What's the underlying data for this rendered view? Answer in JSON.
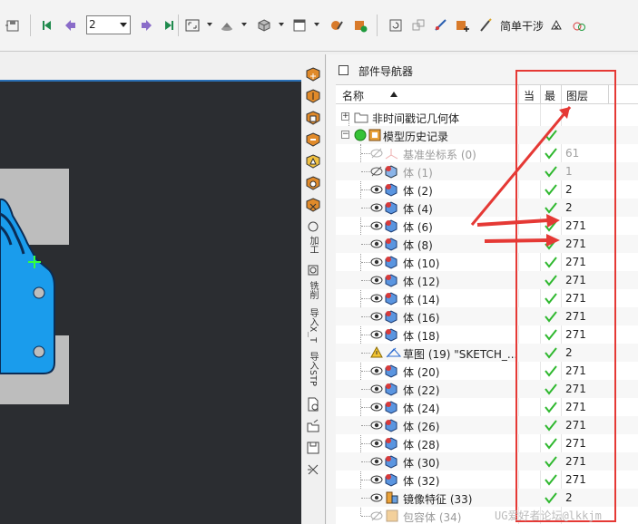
{
  "toolbar": {
    "page_value": "2",
    "simple_interference_label": "简单干涉"
  },
  "navigator": {
    "title": "部件导航器",
    "columns": {
      "name": "名称",
      "current": "当",
      "latest": "最",
      "layer": "图层"
    },
    "items": [
      {
        "label": "非时间戳记几何体",
        "layer": "",
        "checked": false,
        "dim": false,
        "kind": "folder"
      },
      {
        "label": "模型历史记录",
        "layer": "",
        "checked": true,
        "dim": false,
        "kind": "history"
      },
      {
        "label": "基准坐标系 (0)",
        "layer": "61",
        "checked": true,
        "dim": true,
        "kind": "csys"
      },
      {
        "label": "体 (1)",
        "layer": "1",
        "checked": true,
        "dim": true,
        "kind": "body"
      },
      {
        "label": "体 (2)",
        "layer": "2",
        "checked": true,
        "dim": false,
        "kind": "body"
      },
      {
        "label": "体 (4)",
        "layer": "2",
        "checked": true,
        "dim": false,
        "kind": "body"
      },
      {
        "label": "体 (6)",
        "layer": "271",
        "checked": true,
        "dim": false,
        "kind": "body"
      },
      {
        "label": "体 (8)",
        "layer": "271",
        "checked": true,
        "dim": false,
        "kind": "body"
      },
      {
        "label": "体 (10)",
        "layer": "271",
        "checked": true,
        "dim": false,
        "kind": "body"
      },
      {
        "label": "体 (12)",
        "layer": "271",
        "checked": true,
        "dim": false,
        "kind": "body"
      },
      {
        "label": "体 (14)",
        "layer": "271",
        "checked": true,
        "dim": false,
        "kind": "body"
      },
      {
        "label": "体 (16)",
        "layer": "271",
        "checked": true,
        "dim": false,
        "kind": "body"
      },
      {
        "label": "体 (18)",
        "layer": "271",
        "checked": true,
        "dim": false,
        "kind": "body"
      },
      {
        "label": "草图 (19) \"SKETCH_...",
        "layer": "2",
        "checked": true,
        "dim": false,
        "kind": "sketch"
      },
      {
        "label": "体 (20)",
        "layer": "271",
        "checked": true,
        "dim": false,
        "kind": "body"
      },
      {
        "label": "体 (22)",
        "layer": "271",
        "checked": true,
        "dim": false,
        "kind": "body"
      },
      {
        "label": "体 (24)",
        "layer": "271",
        "checked": true,
        "dim": false,
        "kind": "body"
      },
      {
        "label": "体 (26)",
        "layer": "271",
        "checked": true,
        "dim": false,
        "kind": "body"
      },
      {
        "label": "体 (28)",
        "layer": "271",
        "checked": true,
        "dim": false,
        "kind": "body"
      },
      {
        "label": "体 (30)",
        "layer": "271",
        "checked": true,
        "dim": false,
        "kind": "body"
      },
      {
        "label": "体 (32)",
        "layer": "271",
        "checked": true,
        "dim": false,
        "kind": "body"
      },
      {
        "label": "镜像特征 (33)",
        "layer": "2",
        "checked": true,
        "dim": false,
        "kind": "mirror"
      },
      {
        "label": "包容体 (34)",
        "layer": "",
        "checked": false,
        "dim": true,
        "kind": "bbox"
      }
    ]
  },
  "resource_bar": {
    "vertical_labels": [
      "加工",
      "铣削",
      "导入X_T",
      "导入STP"
    ]
  },
  "watermark": "UG爱好者论坛@lkkjm",
  "colors": {
    "accent_red": "#e53935",
    "check_green": "#2fb82f",
    "part_blue": "#1a9cec",
    "viewport_bg": "#2b2d31"
  }
}
